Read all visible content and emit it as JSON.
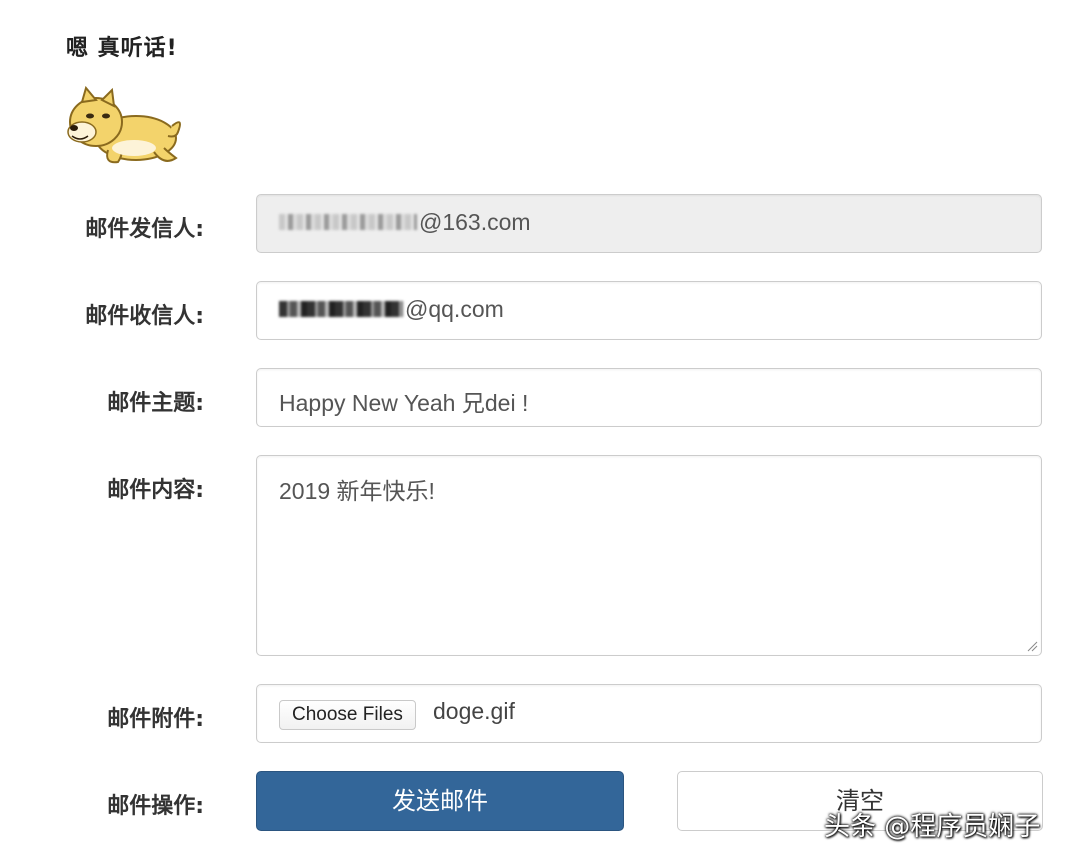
{
  "greeting": "嗯 真听话!",
  "form": {
    "sender": {
      "label": "邮件发信人:",
      "value_visible_suffix": "@163.com"
    },
    "recipient": {
      "label": "邮件收信人:",
      "value_visible_suffix": "@qq.com"
    },
    "subject": {
      "label": "邮件主题:",
      "value": "Happy New Yeah 兄dei !"
    },
    "content": {
      "label": "邮件内容:",
      "value": "2019 新年快乐!"
    },
    "attachment": {
      "label": "邮件附件:",
      "button_label": "Choose Files",
      "file_name": "doge.gif"
    },
    "actions": {
      "label": "邮件操作:",
      "send_label": "发送邮件",
      "clear_label": "清空"
    }
  },
  "watermark": "头条 @程序员娴子",
  "colors": {
    "primary_button": "#336699",
    "readonly_bg": "#eeeeee",
    "border": "#cccccc"
  }
}
